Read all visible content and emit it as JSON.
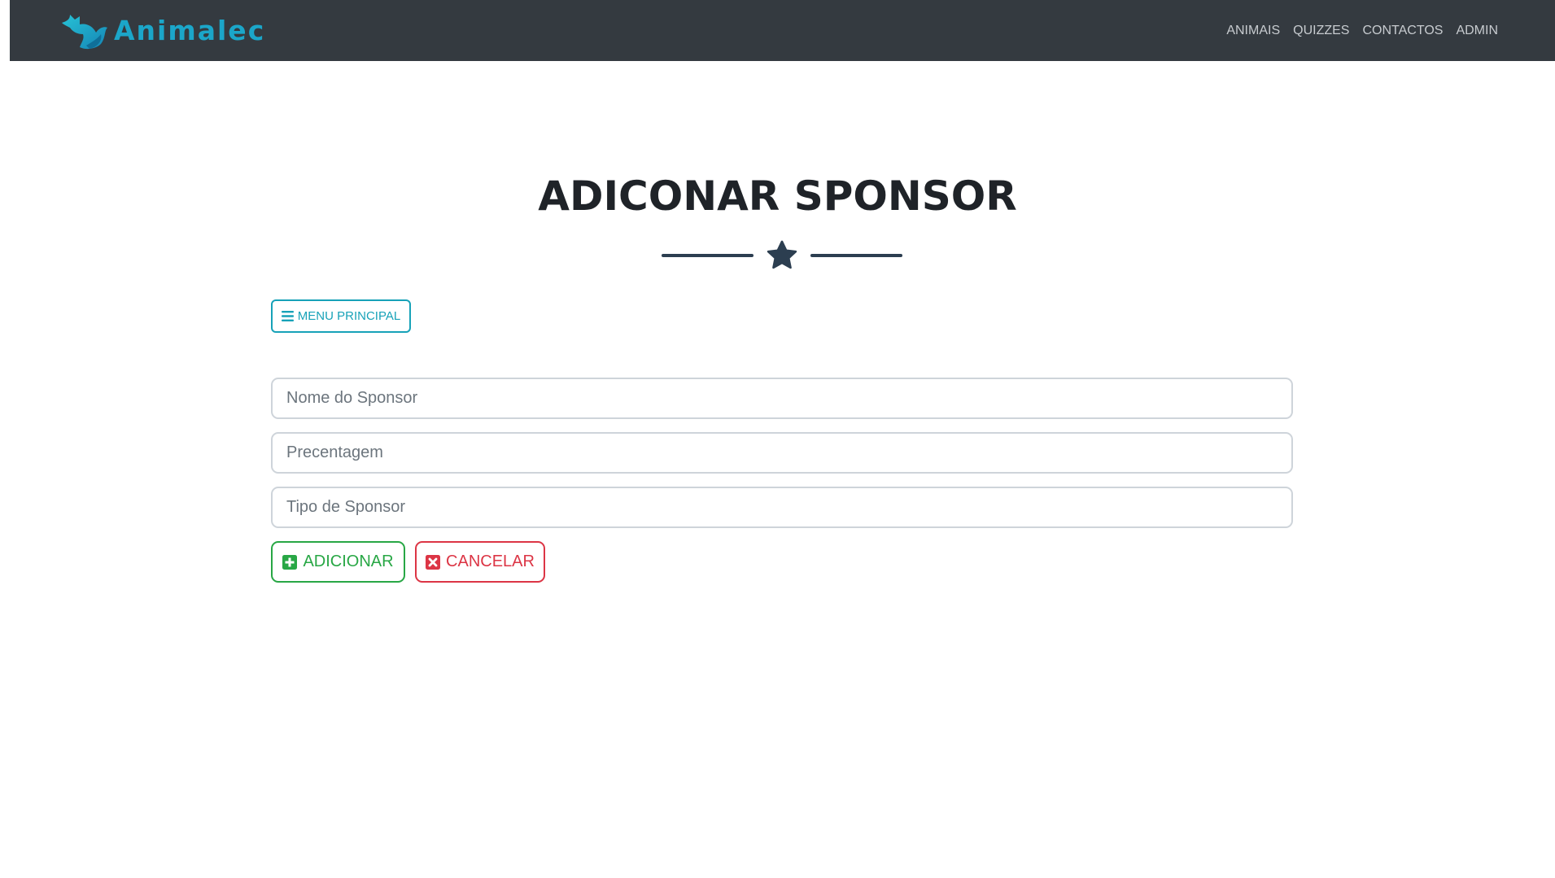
{
  "navbar": {
    "brand": "Animalec",
    "links": [
      {
        "label": "ANIMAIS"
      },
      {
        "label": "QUIZZES"
      },
      {
        "label": "CONTACTOS"
      },
      {
        "label": "ADMIN"
      }
    ]
  },
  "page": {
    "title": "ADICONAR SPONSOR"
  },
  "menu_button": {
    "label": "MENU PRINCIPAL",
    "icon": "bars-icon"
  },
  "form": {
    "fields": [
      {
        "placeholder": "Nome do Sponsor",
        "value": ""
      },
      {
        "placeholder": "Precentagem",
        "value": ""
      },
      {
        "placeholder": "Tipo de Sponsor",
        "value": ""
      }
    ],
    "submit_label": "ADICIONAR",
    "submit_icon": "plus-square-icon",
    "cancel_label": "CANCELAR",
    "cancel_icon": "times-square-icon"
  },
  "colors": {
    "navbar_bg": "#343a40",
    "brand": "#1ba6c9",
    "info": "#17a2b8",
    "success": "#28a745",
    "danger": "#dc3545",
    "divider": "#2c3e50"
  }
}
